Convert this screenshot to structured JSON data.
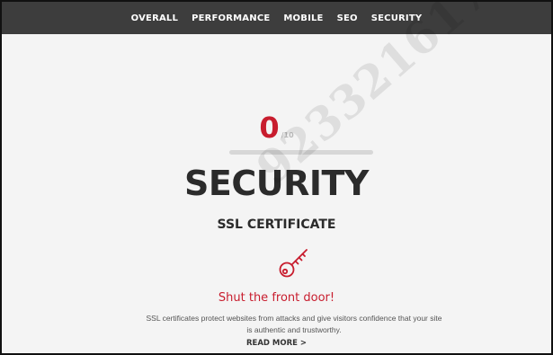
{
  "nav": {
    "items": [
      {
        "label": "OVERALL"
      },
      {
        "label": "PERFORMANCE"
      },
      {
        "label": "MOBILE"
      },
      {
        "label": "SEO"
      },
      {
        "label": "SECURITY"
      }
    ]
  },
  "score": {
    "value": "0",
    "max": "/10",
    "progress_fraction": 0
  },
  "section": {
    "title": "SECURITY",
    "subtitle": "SSL CERTIFICATE",
    "icon": "key-icon",
    "tagline": "Shut the front door!",
    "description": "SSL certificates protect websites from attacks and give visitors confidence that your site is authentic and trustworthy.",
    "read_more": "READ MORE >"
  },
  "watermark": {
    "text": "923321617"
  },
  "colors": {
    "nav_background": "#3d3d3d",
    "accent": "#c81d2e",
    "page_background": "#f4f4f4"
  }
}
